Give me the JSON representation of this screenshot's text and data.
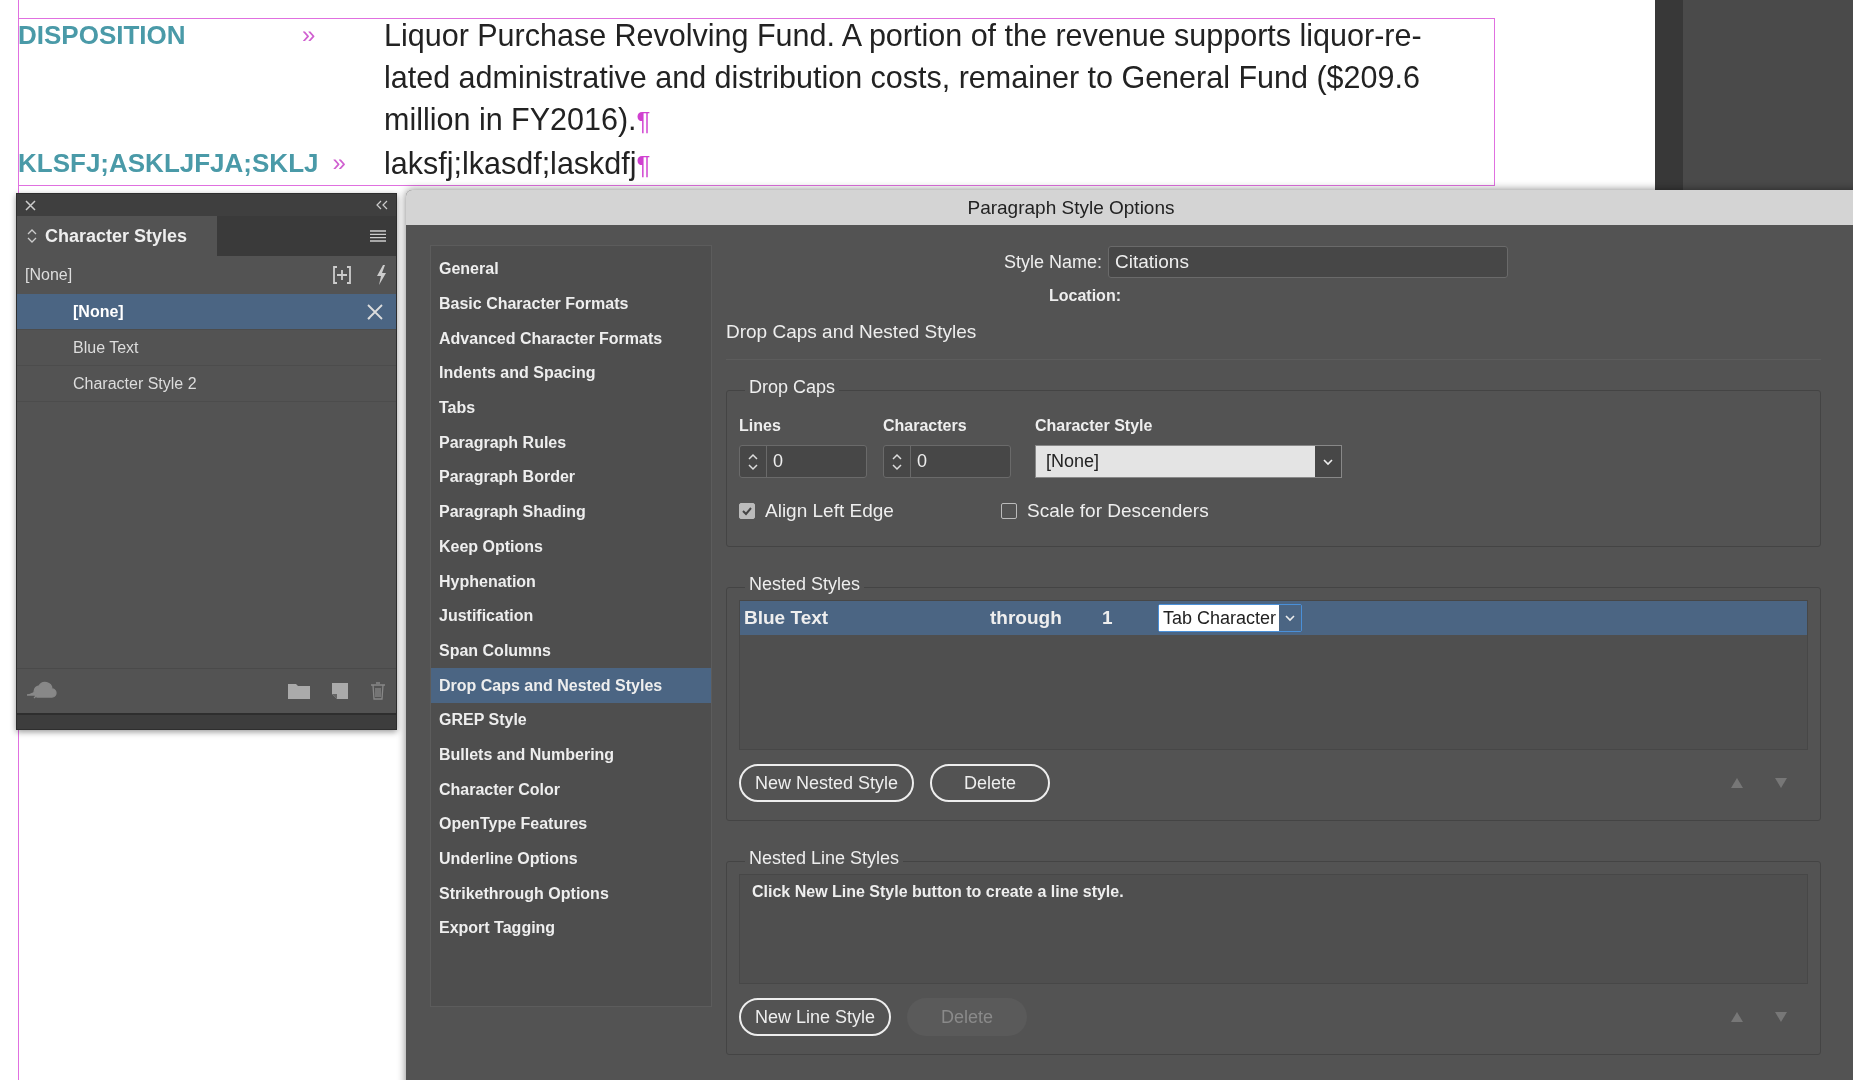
{
  "document": {
    "paragraphs": [
      {
        "label": "DISPOSITION",
        "marker": "»",
        "lines": [
          "Liquor Purchase Revolving Fund. A portion of the revenue supports liquor-re-",
          "lated administrative and distribution costs, remainer to General Fund ($209.6",
          "million in FY2016)."
        ],
        "pilcrow": "¶"
      },
      {
        "label": "KLSFJ;ASKLJFJA;SKLJ",
        "marker": "»",
        "lines": [
          "laksfj;lkasdf;laskdfj"
        ],
        "pilcrow": "¶"
      }
    ]
  },
  "character_styles_panel": {
    "title": "Character Styles",
    "current": "[None]",
    "items": [
      {
        "label": "[None]",
        "selected": true
      },
      {
        "label": "Blue Text",
        "selected": false
      },
      {
        "label": "Character Style 2",
        "selected": false
      }
    ]
  },
  "dialog": {
    "title": "Paragraph Style Options",
    "categories": [
      {
        "label": "General",
        "selected": false
      },
      {
        "label": "Basic Character Formats",
        "selected": false
      },
      {
        "label": "Advanced Character Formats",
        "selected": false
      },
      {
        "label": "Indents and Spacing",
        "selected": false
      },
      {
        "label": "Tabs",
        "selected": false
      },
      {
        "label": "Paragraph Rules",
        "selected": false
      },
      {
        "label": "Paragraph Border",
        "selected": false
      },
      {
        "label": "Paragraph Shading",
        "selected": false
      },
      {
        "label": "Keep Options",
        "selected": false
      },
      {
        "label": "Hyphenation",
        "selected": false
      },
      {
        "label": "Justification",
        "selected": false
      },
      {
        "label": "Span Columns",
        "selected": false
      },
      {
        "label": "Drop Caps and Nested Styles",
        "selected": true
      },
      {
        "label": "GREP Style",
        "selected": false
      },
      {
        "label": "Bullets and Numbering",
        "selected": false
      },
      {
        "label": "Character Color",
        "selected": false
      },
      {
        "label": "OpenType Features",
        "selected": false
      },
      {
        "label": "Underline Options",
        "selected": false
      },
      {
        "label": "Strikethrough Options",
        "selected": false
      },
      {
        "label": "Export Tagging",
        "selected": false
      }
    ],
    "style_name": {
      "label": "Style Name:",
      "value": "Citations"
    },
    "location_label": "Location:",
    "section_title": "Drop Caps and Nested Styles",
    "drop_caps": {
      "title": "Drop Caps",
      "lines": {
        "label": "Lines",
        "value": "0"
      },
      "characters": {
        "label": "Characters",
        "value": "0"
      },
      "character_style": {
        "label": "Character Style",
        "value": "[None]"
      },
      "align_left_edge": {
        "label": "Align Left Edge",
        "checked": true
      },
      "scale_for_descenders": {
        "label": "Scale for Descenders",
        "checked": false
      }
    },
    "nested_styles": {
      "title": "Nested Styles",
      "rows": [
        {
          "style": "Blue Text",
          "mode": "through",
          "count": "1",
          "delimiter": "Tab Character",
          "selected": true
        }
      ],
      "buttons": [
        {
          "label": "New Nested Style",
          "disabled": false
        },
        {
          "label": "Delete",
          "disabled": false
        }
      ]
    },
    "nested_line_styles": {
      "title": "Nested Line Styles",
      "hint": "Click New Line Style button to create a line style.",
      "buttons": [
        {
          "label": "New Line Style",
          "disabled": false
        },
        {
          "label": "Delete",
          "disabled": true
        }
      ]
    }
  }
}
